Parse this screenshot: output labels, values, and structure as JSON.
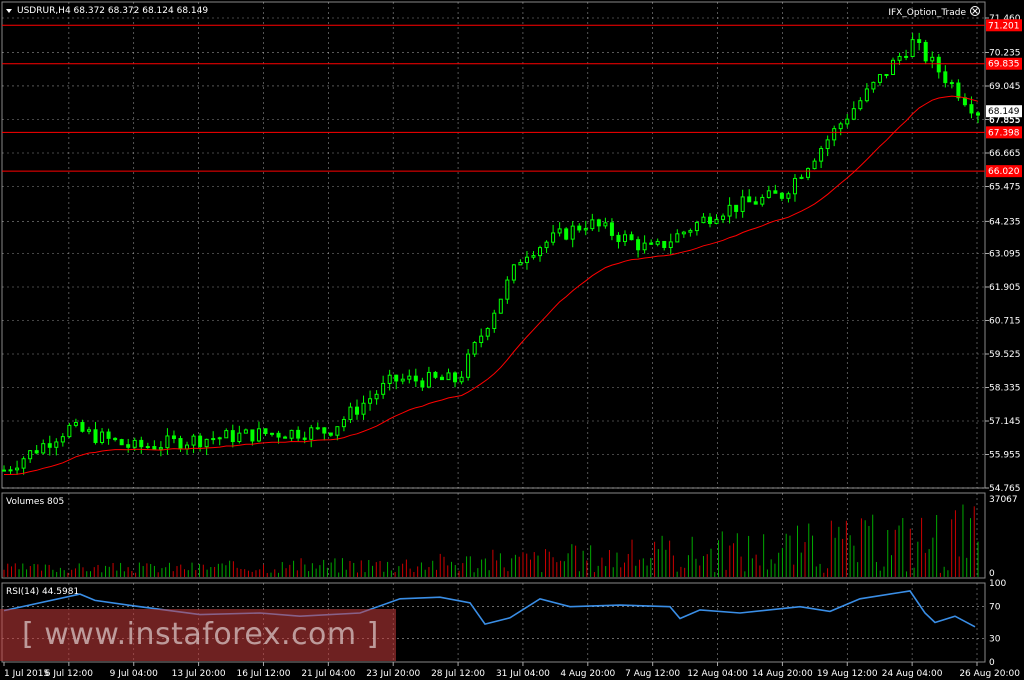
{
  "header": {
    "symbol_info": "USDRUR,H4  68.372 68.372 68.124 68.149",
    "indicator_name": "IFX_Option_Trade"
  },
  "colors": {
    "bull_candle": "#00ff00",
    "ma_line": "#ff0000",
    "rsi_line": "#3a8ee6",
    "level_line": "#ff0000",
    "grid": "#ffffff",
    "volume_up": "#00aa00",
    "volume_down": "#cc0000"
  },
  "levels": [
    "71.201",
    "69.835",
    "67.398",
    "66.020"
  ],
  "price_label": "68.149",
  "price_axis_label_below": "67.855",
  "price_ticks": [
    "71.460",
    "70.235",
    "69.045",
    "67.855",
    "66.665",
    "65.475",
    "64.235",
    "63.095",
    "61.905",
    "60.715",
    "59.525",
    "58.335",
    "57.145",
    "55.955",
    "54.765"
  ],
  "volume_panel": {
    "label": "Volumes 805",
    "ticks": [
      "37067",
      "0"
    ]
  },
  "rsi_panel": {
    "label": "RSI(14) 44.5981",
    "ticks": [
      "100",
      "70",
      "30",
      "0"
    ]
  },
  "time_labels": [
    "1 Jul 2015",
    "6 Jul 12:00",
    "9 Jul 04:00",
    "13 Jul 20:00",
    "16 Jul 12:00",
    "21 Jul 04:00",
    "23 Jul 20:00",
    "28 Jul 12:00",
    "31 Jul 04:00",
    "4 Aug 20:00",
    "7 Aug 12:00",
    "12 Aug 04:00",
    "14 Aug 20:00",
    "19 Aug 12:00",
    "24 Aug 04:00",
    "26 Aug 20:00"
  ],
  "watermark": "[ www.instaforex.com ]",
  "chart_data": {
    "type": "candlestick",
    "symbol": "USDRUR",
    "timeframe": "H4",
    "last": {
      "open": 68.372,
      "high": 68.372,
      "low": 68.124,
      "close": 68.149
    },
    "ylim": [
      54.765,
      71.46
    ],
    "horizontal_levels": [
      71.201,
      69.835,
      67.398,
      66.02
    ],
    "price_path": [
      {
        "x": "1 Jul 2015",
        "y": 55.4
      },
      {
        "x": "6 Jul 12:00",
        "y": 56.9
      },
      {
        "x": "9 Jul 04:00",
        "y": 56.2
      },
      {
        "x": "13 Jul 20:00",
        "y": 56.5
      },
      {
        "x": "16 Jul 12:00",
        "y": 56.7
      },
      {
        "x": "21 Jul 04:00",
        "y": 56.8
      },
      {
        "x": "23 Jul 20:00",
        "y": 58.6
      },
      {
        "x": "28 Jul 12:00",
        "y": 58.6
      },
      {
        "x": "31 Jul 04:00",
        "y": 63.1
      },
      {
        "x": "4 Aug 20:00",
        "y": 64.2
      },
      {
        "x": "7 Aug 12:00",
        "y": 63.2
      },
      {
        "x": "12 Aug 04:00",
        "y": 64.6
      },
      {
        "x": "14 Aug 20:00",
        "y": 65.2
      },
      {
        "x": "19 Aug 12:00",
        "y": 68.0
      },
      {
        "x": "24 Aug 04:00",
        "y": 70.6
      },
      {
        "x": "26 Aug 20:00",
        "y": 68.15
      }
    ],
    "volume_max": 37067,
    "rsi": {
      "period": 14,
      "last": 44.5981,
      "levels": [
        70,
        30
      ]
    }
  }
}
